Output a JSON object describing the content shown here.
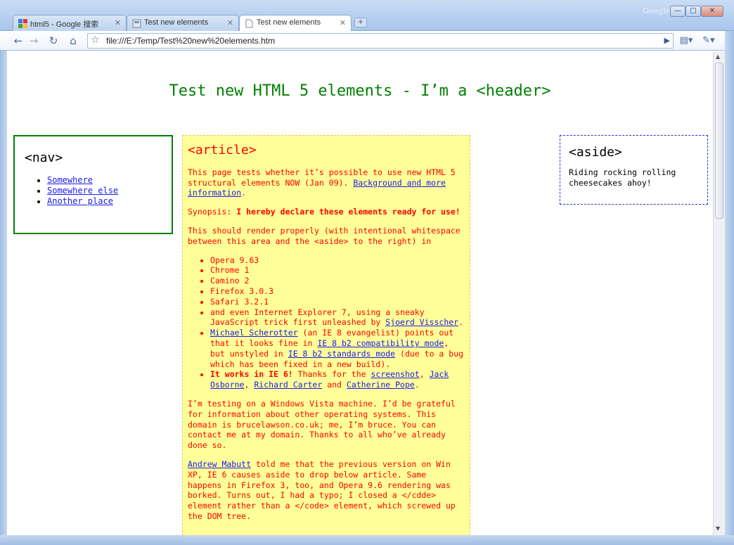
{
  "browser": {
    "brand": "Google",
    "window_controls": {
      "minimize": "—",
      "maximize": "□",
      "close": "✕"
    },
    "tabs": [
      {
        "label": "html5 - Google 搜索",
        "icon": "google-favicon"
      },
      {
        "label": "Test new elements",
        "icon": "page-favicon"
      },
      {
        "label": "Test new elements",
        "icon": "page-favicon",
        "active": true
      }
    ],
    "url": "file:///E:/Temp/Test%20new%20elements.htm"
  },
  "page": {
    "header": "Test new HTML 5 elements - I’m a <header>",
    "nav": {
      "title": "<nav>",
      "links": [
        "Somewhere",
        "Somewhere else",
        "Another place"
      ]
    },
    "article": {
      "title": "<article>",
      "p1_text": "This page tests whether it’s possible to use new HTML 5 structural elements NOW (Jan 09). ",
      "p1_link": "Background and more information",
      "p1_end": ".",
      "synopsis_label": "Synopsis: ",
      "synopsis_bold": "I hereby declare these elements ready for use!",
      "p3": "This should render properly (with intentional whitespace between this area and the <aside> to the right) in",
      "browsers": [
        "Opera 9.63",
        "Chrome 1",
        "Camino 2",
        "Firefox 3.0.3",
        "Safari 3.2.1"
      ],
      "ie7_text": "and even Internet Explorer 7, using a sneaky JavaScript trick first unleashed by ",
      "ie7_link": "Sjoerd Visscher",
      "ie7_end": ".",
      "ie8_link1": "Michael Scherotter",
      "ie8_text1": " (an IE 8 evangelist) points out that it looks fine in ",
      "ie8_link2": "IE 8 b2 compatibility mode",
      "ie8_text2": ", but unstyled in ",
      "ie8_link3": "IE 8 b2 standards mode",
      "ie8_text3": " (due to a bug which has been fixed in a new build).",
      "ie6_bold": "It works in IE 6!",
      "ie6_text1": " Thanks for the ",
      "ie6_link1": "screenshot",
      "ie6_sep1": ", ",
      "ie6_link2": "Jack Osborne",
      "ie6_sep2": ", ",
      "ie6_link3": "Richard Carter",
      "ie6_sep3": " and ",
      "ie6_link4": "Catherine Pope",
      "ie6_end": ".",
      "p4": "I’m testing on a Windows Vista machine. I’d be grateful for information about other operating systems. This domain is brucelawson.co.uk; me, I’m bruce. You can contact me at my domain. Thanks to all who’ve already done so.",
      "p5_link": "Andrew Mabutt",
      "p5_text": " told me that the previous version on Win XP, IE 6 causes aside to drop below article. Same happens in Firefox 3, too, and Opera 9.6 rendering was borked. Turns out, I had a typo; I closed a </cdde> element rather than a </code> element, which screwed up the DOM tree."
    },
    "aside": {
      "title": "<aside>",
      "text": "Riding rocking rolling cheesecakes ahoy!"
    }
  },
  "colors": {
    "header": "#008000",
    "article_bg": "#ffff99",
    "article_text": "#ff0000",
    "link": "#1a1aee"
  }
}
